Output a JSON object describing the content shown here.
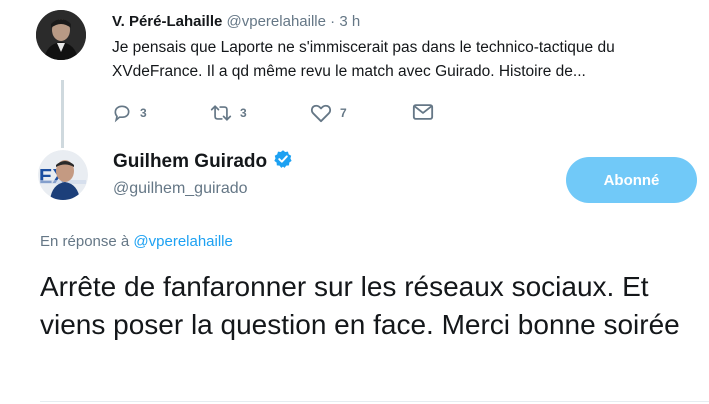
{
  "parent_tweet": {
    "author_name": "V. Péré-Lahaille",
    "author_handle": "@vperelahaille",
    "separator": " · ",
    "time": "3 h",
    "text": "Je pensais que Laporte ne s'immiscerait pas dans le technico-tactique du XVdeFrance. Il a qd même revu le match avec Guirado. Histoire de...",
    "actions": {
      "reply_count": "3",
      "retweet_count": "3",
      "like_count": "7"
    }
  },
  "reply_tweet": {
    "author_name": "Guilhem Guirado",
    "author_handle": "@guilhem_guirado",
    "verified": true,
    "follow_button_label": "Abonné",
    "replying_prefix": "En réponse à ",
    "replying_to": "@vperelahaille",
    "text": "Arrête de fanfaronner sur les réseaux sociaux. Et viens poser la question en face. Merci bonne soirée"
  },
  "colors": {
    "accent": "#1da1f2",
    "follow_button": "#71c9f8",
    "muted": "#657786",
    "thread_line": "#cfd9de"
  },
  "icons": [
    "reply-icon",
    "retweet-icon",
    "like-icon",
    "message-icon",
    "verified-badge-icon"
  ]
}
